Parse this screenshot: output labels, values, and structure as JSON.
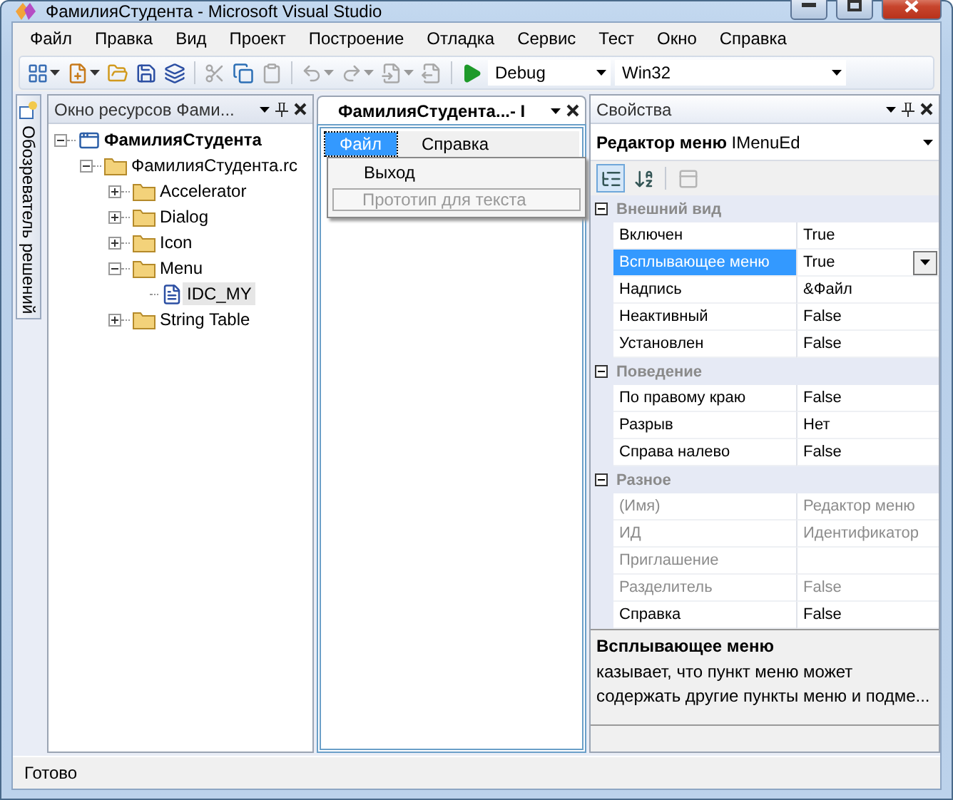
{
  "window": {
    "title": "ФамилияСтудента - Microsoft Visual Studio"
  },
  "menu": [
    "Файл",
    "Правка",
    "Вид",
    "Проект",
    "Построение",
    "Отладка",
    "Сервис",
    "Тест",
    "Окно",
    "Справка"
  ],
  "toolbar": {
    "buttons": [
      {
        "kind": "new-project",
        "disabled": false,
        "menu": true
      },
      {
        "kind": "add-item",
        "disabled": false,
        "menu": true
      },
      {
        "kind": "open",
        "disabled": false,
        "menu": false
      },
      {
        "kind": "save",
        "disabled": false,
        "menu": false
      },
      {
        "kind": "save-all",
        "disabled": false,
        "menu": false
      },
      {
        "kind": "cut",
        "disabled": true,
        "menu": false
      },
      {
        "kind": "copy",
        "disabled": false,
        "menu": false
      },
      {
        "kind": "paste",
        "disabled": true,
        "menu": false
      },
      {
        "kind": "undo",
        "disabled": true,
        "menu": true
      },
      {
        "kind": "redo",
        "disabled": true,
        "menu": true
      },
      {
        "kind": "navigate-back",
        "disabled": true,
        "menu": true
      },
      {
        "kind": "navigate-forward",
        "disabled": true,
        "menu": false
      },
      {
        "kind": "start",
        "disabled": false,
        "menu": false
      }
    ],
    "configuration": "Debug",
    "platform": "Win32"
  },
  "side_tab": "Обозреватель решений",
  "resource_view": {
    "title": "Окно ресурсов Фами...",
    "tree": [
      {
        "label": "ФамилияСтудента",
        "kind": "project",
        "expanded": true,
        "selected": false,
        "children": [
          {
            "label": "ФамилияСтудента.rc",
            "kind": "file",
            "expanded": true,
            "selected": false,
            "children": [
              {
                "label": "Accelerator",
                "kind": "folder",
                "expanded": false,
                "selected": false
              },
              {
                "label": "Dialog",
                "kind": "folder",
                "expanded": false,
                "selected": false
              },
              {
                "label": "Icon",
                "kind": "folder",
                "expanded": false,
                "selected": false
              },
              {
                "label": "Menu",
                "kind": "folder",
                "expanded": true,
                "selected": false,
                "children": [
                  {
                    "label": "IDC_MY",
                    "kind": "menu-resource",
                    "selected": true
                  }
                ]
              },
              {
                "label": "String Table",
                "kind": "folder",
                "expanded": false,
                "selected": false
              }
            ]
          }
        ]
      }
    ]
  },
  "editor": {
    "tab": "ФамилияСтудента...- I",
    "menu_bar": [
      {
        "label": "Файл",
        "selected": true
      },
      {
        "label": "Справка",
        "selected": false
      }
    ],
    "dropdown": [
      {
        "label": "Выход",
        "kind": "item"
      },
      {
        "label": "Прототип для текста",
        "kind": "placeholder"
      }
    ]
  },
  "properties": {
    "title": "Свойства",
    "object": "**Редактор меню** IMenuEd",
    "tools": [
      {
        "kind": "categorized",
        "selected": true,
        "disabled": false
      },
      {
        "kind": "alphabetical",
        "selected": false,
        "disabled": false
      },
      {
        "kind": "property-pages",
        "selected": false,
        "disabled": true
      }
    ],
    "categories": [
      {
        "name": "Внешний вид",
        "expanded": true,
        "rows": [
          {
            "name": "Включен",
            "value": "True",
            "selected": false,
            "disabled": false
          },
          {
            "name": "Всплывающее меню",
            "value": "True",
            "selected": true,
            "disabled": false
          },
          {
            "name": "Надпись",
            "value": "&Файл",
            "selected": false,
            "disabled": false
          },
          {
            "name": "Неактивный",
            "value": "False",
            "selected": false,
            "disabled": false
          },
          {
            "name": "Установлен",
            "value": "False",
            "selected": false,
            "disabled": false
          }
        ]
      },
      {
        "name": "Поведение",
        "expanded": true,
        "rows": [
          {
            "name": "По правому краю",
            "value": "False",
            "selected": false,
            "disabled": false
          },
          {
            "name": "Разрыв",
            "value": "Нет",
            "selected": false,
            "disabled": false
          },
          {
            "name": "Справа налево",
            "value": "False",
            "selected": false,
            "disabled": false
          }
        ]
      },
      {
        "name": "Разное",
        "expanded": true,
        "rows": [
          {
            "name": "(Имя)",
            "value": "Редактор меню",
            "selected": false,
            "disabled": true
          },
          {
            "name": "ИД",
            "value": "Идентификатор",
            "selected": false,
            "disabled": true
          },
          {
            "name": "Приглашение",
            "selected": false,
            "disabled": true
          },
          {
            "name": "Разделитель",
            "value": "False",
            "selected": false,
            "disabled": true
          },
          {
            "name": "Справка",
            "value": "False",
            "selected": false,
            "disabled": false
          }
        ]
      }
    ],
    "description": {
      "title": "Всплывающее меню",
      "text": "казывает, что пункт меню может содержать другие пункты меню и подме..."
    }
  },
  "status_bar": "Готово"
}
